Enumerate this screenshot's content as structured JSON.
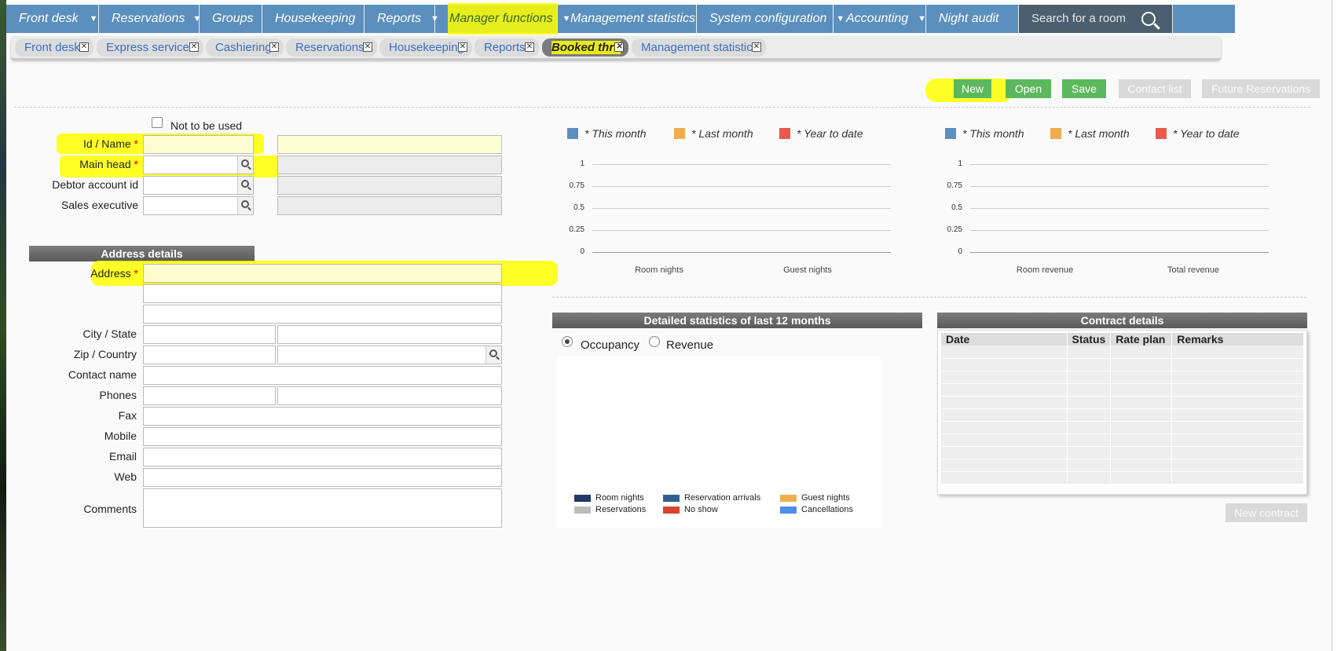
{
  "nav": {
    "items": [
      {
        "label": "Front desk",
        "caret": true
      },
      {
        "label": "Reservations",
        "caret": true
      },
      {
        "label": "Groups",
        "caret": false
      },
      {
        "label": "Housekeeping",
        "caret": false
      },
      {
        "label": "Reports",
        "caret": true
      },
      {
        "label": "Manager functions",
        "caret": true
      },
      {
        "label": "Management statistics",
        "caret": false
      },
      {
        "label": "System configuration",
        "caret": true
      },
      {
        "label": "Accounting",
        "caret": true
      },
      {
        "label": "Night audit",
        "caret": false
      }
    ],
    "search_label": "Search for a room"
  },
  "tabs": [
    "Front desk",
    "Express services",
    "Cashiering",
    "Reservations",
    "Housekeeping",
    "Reports",
    "Booked thru",
    "Management statistics"
  ],
  "active_tab": "Booked thru",
  "toolbar": {
    "new": "New",
    "open": "Open",
    "save": "Save",
    "contact_list": "Contact list",
    "future_reservations": "Future Reservations"
  },
  "form": {
    "not_to_be_used": "Not to be used",
    "id_name": "Id / Name",
    "main_head": "Main head",
    "debtor_account_id": "Debtor account id",
    "sales_executive": "Sales executive",
    "address_details": "Address details",
    "address": "Address",
    "city_state": "City / State",
    "zip_country": "Zip / Country",
    "contact_name": "Contact name",
    "phones": "Phones",
    "fax": "Fax",
    "mobile": "Mobile",
    "email": "Email",
    "web": "Web",
    "comments": "Comments",
    "required_mark": "*"
  },
  "colors": {
    "nav": "#5b8fbd",
    "green": "#5cb85c",
    "this_month": "#5b8fbd",
    "last_month": "#f0ad4e",
    "year_to_date": "#e9594c"
  },
  "chart_data": [
    {
      "type": "bar",
      "categories": [
        "Room nights",
        "Guest nights"
      ],
      "series": [
        {
          "name": "* This month",
          "values": [
            0,
            0
          ]
        },
        {
          "name": "* Last month",
          "values": [
            0,
            0
          ]
        },
        {
          "name": "* Year to date",
          "values": [
            0,
            0
          ]
        }
      ],
      "yticks": [
        "1",
        "0.75",
        "0.5",
        "0.25",
        "0"
      ],
      "ylim": [
        0,
        1
      ],
      "grid": true,
      "legend": "top"
    },
    {
      "type": "bar",
      "categories": [
        "Room revenue",
        "Total revenue"
      ],
      "series": [
        {
          "name": "* This month",
          "values": [
            0,
            0
          ]
        },
        {
          "name": "* Last month",
          "values": [
            0,
            0
          ]
        },
        {
          "name": "* Year to date",
          "values": [
            0,
            0
          ]
        }
      ],
      "yticks": [
        "1",
        "0.75",
        "0.5",
        "0.25",
        "0"
      ],
      "ylim": [
        0,
        1
      ],
      "grid": true,
      "legend": "top"
    }
  ],
  "detailed": {
    "title": "Detailed statistics of last 12 months",
    "occupancy": "Occupancy",
    "revenue": "Revenue",
    "legend": [
      {
        "name": "Room nights",
        "color": "#1f3a68"
      },
      {
        "name": "Reservation arrivals",
        "color": "#2e5f93"
      },
      {
        "name": "Guest nights",
        "color": "#f0ad4e"
      },
      {
        "name": "Reservations",
        "color": "#bdbdbd"
      },
      {
        "name": "No show",
        "color": "#d9432b"
      },
      {
        "name": "Cancellations",
        "color": "#4a8ee8"
      }
    ]
  },
  "contract": {
    "title": "Contract details",
    "columns": [
      "Date",
      "Status",
      "Rate plan",
      "Remarks"
    ],
    "new_contract": "New contract"
  }
}
